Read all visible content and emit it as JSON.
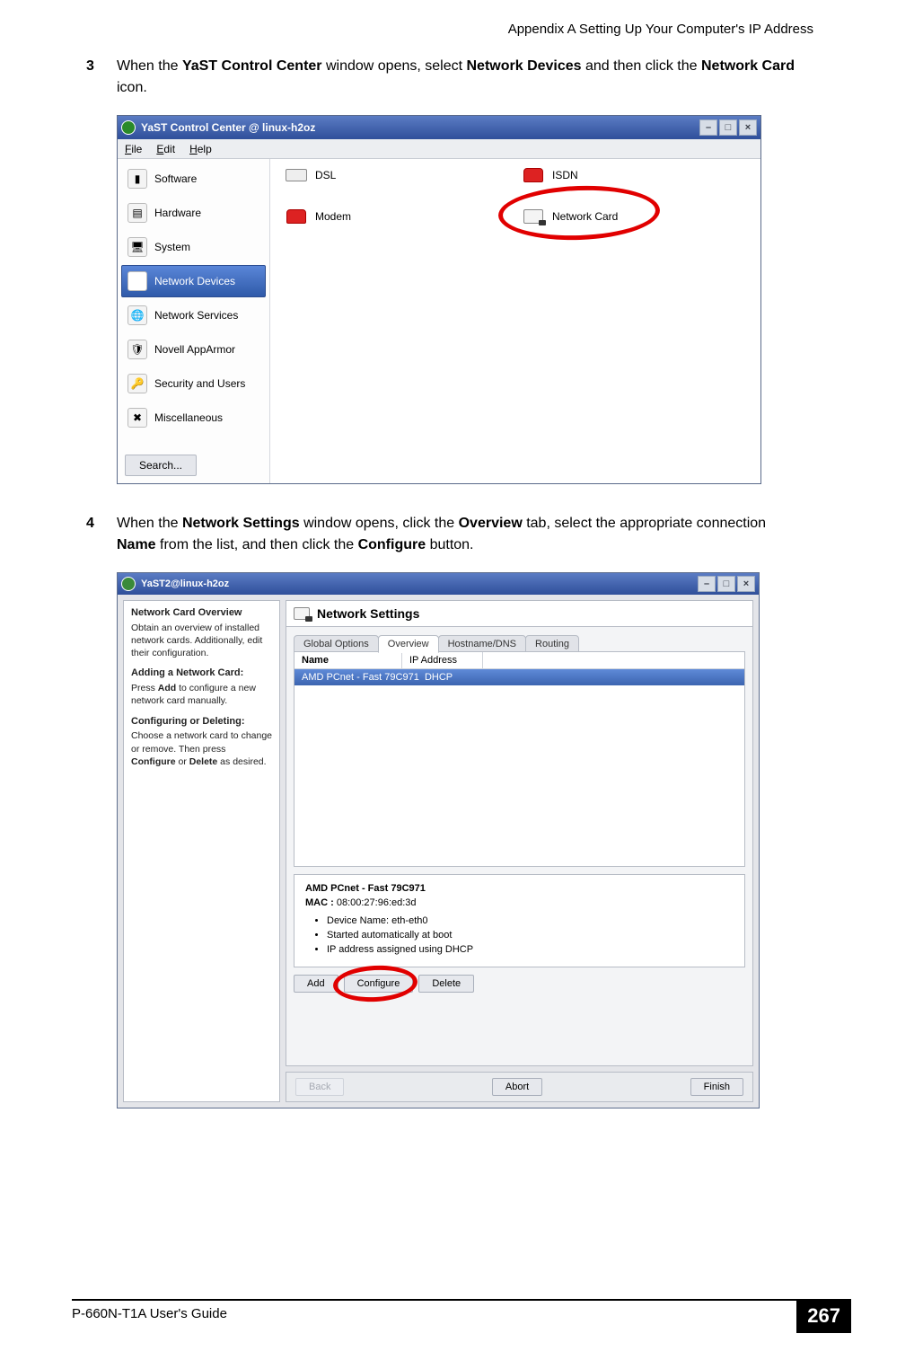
{
  "header": {
    "running": "Appendix A Setting Up Your Computer's IP Address"
  },
  "steps": {
    "s3": {
      "num": "3",
      "t1": "When the ",
      "b1": "YaST Control Center",
      "t2": " window opens, select ",
      "b2": "Network Devices",
      "t3": " and then click the ",
      "b3": "Network Card",
      "t4": " icon."
    },
    "s4": {
      "num": "4",
      "t1": "When the ",
      "b1": "Network Settings",
      "t2": " window opens, click the ",
      "b2": "Overview",
      "t3": " tab, select the appropriate connection ",
      "b3": "Name",
      "t4": " from the list, and then click the ",
      "b4": "Configure",
      "t5": " button."
    }
  },
  "shot1": {
    "title": "YaST Control Center @ linux-h2oz",
    "menu": {
      "file": "File",
      "edit": "Edit",
      "help": "Help"
    },
    "side": [
      "Software",
      "Hardware",
      "System",
      "Network Devices",
      "Network Services",
      "Novell AppArmor",
      "Security and Users",
      "Miscellaneous"
    ],
    "search": "Search...",
    "items": {
      "dsl": "DSL",
      "modem": "Modem",
      "isdn": "ISDN",
      "netcard": "Network Card"
    }
  },
  "shot2": {
    "title": "YaST2@linux-h2oz",
    "help": {
      "h1": "Network Card Overview",
      "p1": "Obtain an overview of installed network cards. Additionally, edit their configuration.",
      "h2": "Adding a Network Card:",
      "p2_a": "Press ",
      "p2_b": "Add",
      "p2_c": " to configure a new network card manually.",
      "h3": "Configuring or Deleting:",
      "p3_a": "Choose a network card to change or remove. Then press ",
      "p3_b": "Configure",
      "p3_c": " or ",
      "p3_d": "Delete",
      "p3_e": " as desired."
    },
    "panel_title": "Network Settings",
    "tabs": {
      "global": "Global Options",
      "overview": "Overview",
      "dns": "Hostname/DNS",
      "routing": "Routing"
    },
    "list": {
      "col_name": "Name",
      "col_ip": "IP Address",
      "row_name": "AMD PCnet - Fast 79C971",
      "row_ip": "DHCP"
    },
    "detail": {
      "model": "AMD PCnet - Fast 79C971",
      "mac_label": "MAC :",
      "mac": "08:00:27:96:ed:3d",
      "li1": "Device Name: eth-eth0",
      "li2": "Started automatically at boot",
      "li3": "IP address assigned using DHCP"
    },
    "buttons": {
      "add": "Add",
      "configure": "Configure",
      "del": "Delete"
    },
    "nav": {
      "back": "Back",
      "abort": "Abort",
      "finish": "Finish"
    }
  },
  "footer": {
    "guide": "P-660N-T1A User's Guide",
    "page": "267"
  }
}
